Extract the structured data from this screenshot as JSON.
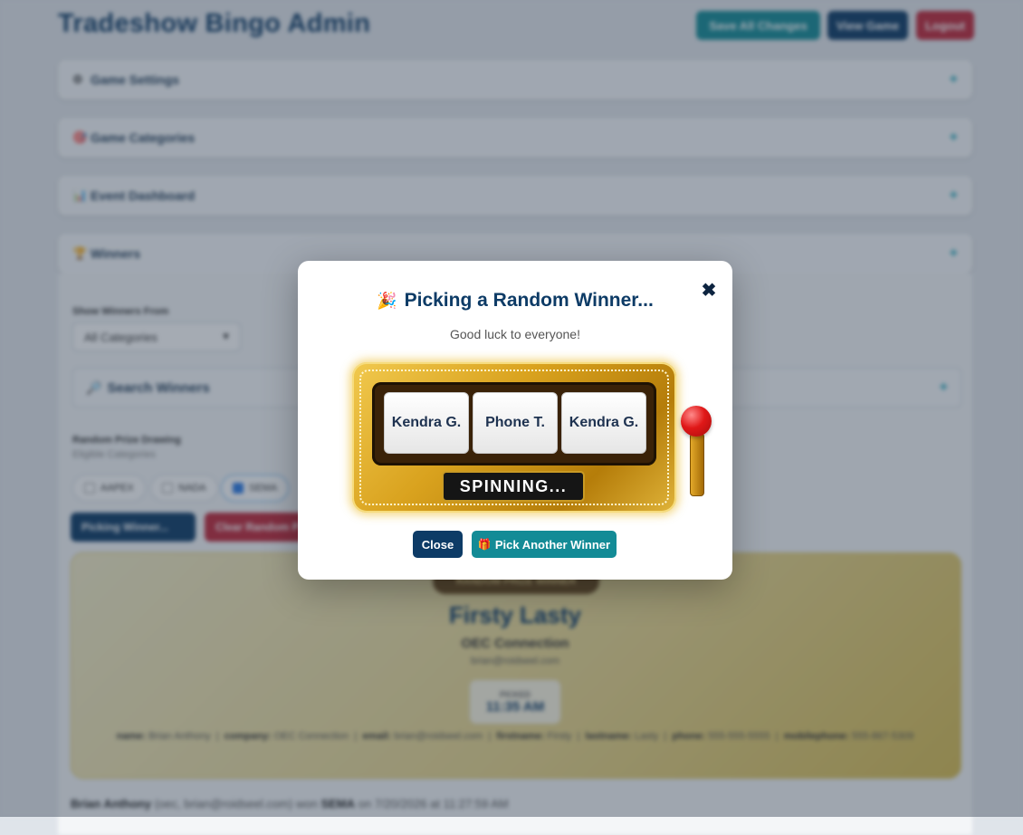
{
  "app": {
    "title": "Tradeshow Bingo Admin",
    "buttons": {
      "save": "Save All Changes",
      "view_game": "View Game",
      "logout": "Logout"
    }
  },
  "panels": [
    {
      "icon": "⚙",
      "title": "Game Settings",
      "toggle": "+"
    },
    {
      "icon": "🎯",
      "title": "Game Categories",
      "toggle": "+"
    },
    {
      "icon": "📊",
      "title": "Event Dashboard",
      "toggle": "+"
    },
    {
      "icon": "🏆",
      "title": "Winners",
      "toggle": "+"
    }
  ],
  "winners": {
    "filter_label": "Show Winners From",
    "filter_value": "All Categories",
    "search_title": "Search Winners",
    "random_title": "Random Prize Drawing",
    "random_sub": "Eligible Categories",
    "chips": [
      "AAPEX",
      "NADA",
      "SEMA"
    ],
    "picking_btn": "Picking Winner...",
    "clear_btn": "Clear Random P",
    "card": {
      "badge": "RANDOM PRIZE WINNER",
      "name": "Firsty Lasty",
      "company": "OEC Connection",
      "email": "brian@roidseel.com",
      "picked_label": "PICKED",
      "picked_time": "11:35 AM",
      "details": [
        {
          "k": "name:",
          "v": "Brian Anthony"
        },
        {
          "k": "company:",
          "v": "OEC Connection"
        },
        {
          "k": "email:",
          "v": "brian@roidseel.com"
        },
        {
          "k": "firstname:",
          "v": "Firsty"
        },
        {
          "k": "lastname:",
          "v": "Lasty"
        },
        {
          "k": "phone:",
          "v": "555-555-5555"
        },
        {
          "k": "mobilephone:",
          "v": "555-867-5309"
        }
      ]
    },
    "log": {
      "name": "Brian Anthony",
      "mid": "(oec, brian@roidseel.com) won",
      "cat": "SEMA",
      "tail": "on 7/20/2026 at 11:27:59 AM"
    }
  },
  "modal": {
    "title_icon": "🎉",
    "title": "Picking a Random Winner...",
    "subtitle": "Good luck to everyone!",
    "reels": [
      "Kendra G.",
      "Phone T.",
      "Kendra G."
    ],
    "status": "SPINNING...",
    "close_label": "Close",
    "pick_icon": "🎁",
    "pick_label": "Pick Another Winner",
    "close_icon": "✖"
  },
  "colors": {
    "brand": "#0d3b66",
    "teal": "#138b96",
    "danger": "#c0283a",
    "gold": "#d9a21e"
  }
}
